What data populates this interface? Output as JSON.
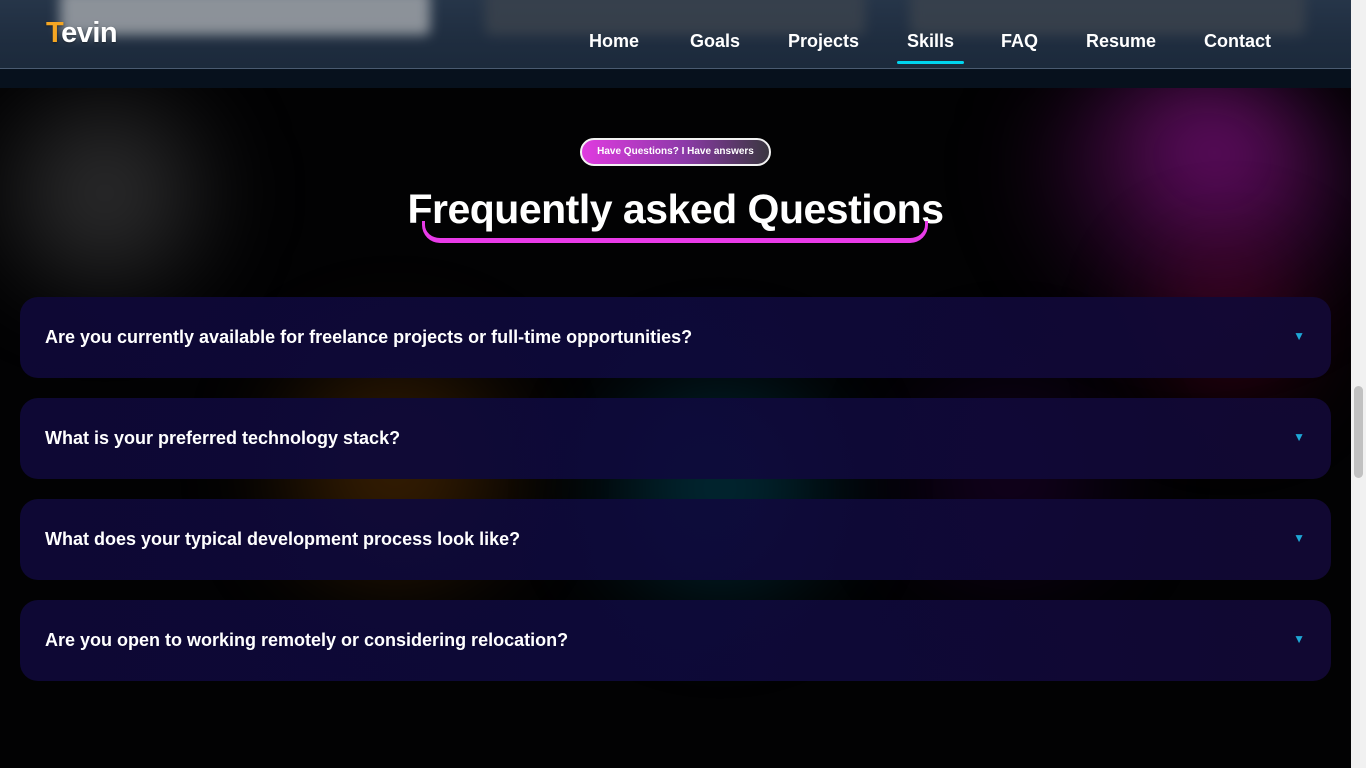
{
  "brand": {
    "logo_first": "T",
    "logo_rest": "evin"
  },
  "nav": {
    "links": [
      {
        "label": "Home"
      },
      {
        "label": "Goals"
      },
      {
        "label": "Projects"
      },
      {
        "label": "Skills",
        "active": true
      },
      {
        "label": "FAQ"
      },
      {
        "label": "Resume"
      },
      {
        "label": "Contact"
      }
    ]
  },
  "faq": {
    "badge": "Have Questions? I Have answers",
    "title": "Frequently asked Questions",
    "items": [
      {
        "question": "Are you currently available for freelance projects or full-time opportunities?",
        "arrow": "▼"
      },
      {
        "question": "What is your preferred technology stack?",
        "arrow": "▼"
      },
      {
        "question": "What does your typical development process look like?",
        "arrow": "▼"
      },
      {
        "question": "Are you open to working remotely or considering relocation?",
        "arrow": "▼"
      }
    ]
  },
  "colors": {
    "accent_cyan": "#00d5f0",
    "accent_magenta": "#e83be8",
    "logo_orange": "#f5a623",
    "card_bg": "#0e0836"
  },
  "icons": {
    "expand": "chevron-down-icon"
  }
}
